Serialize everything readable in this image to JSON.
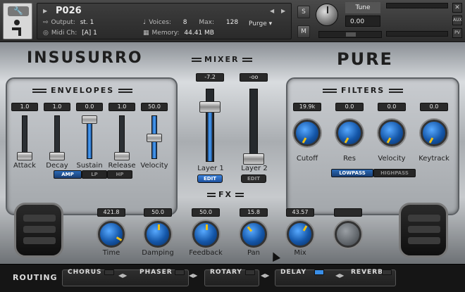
{
  "header": {
    "instrument_name": "P026",
    "output_label": "Output:",
    "output_value": "st. 1",
    "midi_label": "Midi Ch:",
    "midi_value": "[A] 1",
    "voices_label": "Voices:",
    "voices_value": "8",
    "max_label": "Max:",
    "max_value": "128",
    "memory_label": "Memory:",
    "memory_value": "44.41 MB",
    "purge_label": "Purge",
    "solo_label": "S",
    "mute_label": "M",
    "tune_label": "Tune",
    "tune_value": "0.00",
    "close_label": "✕",
    "aux_label": "AUX",
    "pv_label": "PV"
  },
  "brand_left": "INSUSURRO",
  "brand_right": "PURE",
  "envelopes": {
    "title": "ENVELOPES",
    "sliders": [
      {
        "label": "Attack",
        "value": "1.0",
        "level": 0.0
      },
      {
        "label": "Decay",
        "value": "1.0",
        "level": 0.0
      },
      {
        "label": "Sustain",
        "value": "0.0",
        "level": 1.0
      },
      {
        "label": "Release",
        "value": "1.0",
        "level": 0.0
      },
      {
        "label": "Velocity",
        "value": "50.0",
        "level": 0.5
      }
    ],
    "modes": [
      "AMP",
      "LP",
      "HP"
    ],
    "active_mode": "AMP"
  },
  "mixer": {
    "title": "MIXER",
    "layer1": {
      "label": "Layer 1",
      "value": "-7.2",
      "edit": "EDIT"
    },
    "layer2": {
      "label": "Layer 2",
      "value": "-oo",
      "edit": "EDIT"
    },
    "fx_label": "FX"
  },
  "filters": {
    "title": "FILTERS",
    "knobs": [
      {
        "label": "Cutoff",
        "value": "19.9k"
      },
      {
        "label": "Res",
        "value": "0.0"
      },
      {
        "label": "Velocity",
        "value": "0.0"
      },
      {
        "label": "Keytrack",
        "value": "0.0"
      }
    ],
    "modes": [
      "LOWPASS",
      "HIGHPASS"
    ],
    "active_mode": "LOWPASS"
  },
  "fx": {
    "knobs": [
      {
        "label": "Time",
        "value": "421.8"
      },
      {
        "label": "Damping",
        "value": "50.0"
      },
      {
        "label": "Feedback",
        "value": "50.0"
      },
      {
        "label": "Pan",
        "value": "15.8"
      },
      {
        "label": "Mix",
        "value": "43.57"
      },
      {
        "label": "",
        "value": ""
      }
    ]
  },
  "routing": {
    "label": "ROUTING",
    "slots": [
      {
        "name": "CHORUS",
        "on": false
      },
      {
        "name": "PHASER",
        "on": false
      },
      {
        "name": "ROTARY",
        "on": false
      },
      {
        "name": "DELAY",
        "on": true
      },
      {
        "name": "REVERB",
        "on": false
      }
    ]
  },
  "colors": {
    "accent_blue": "#2a7be0",
    "knob_indicator": "#f2c011",
    "panel_dark": "#151515"
  }
}
